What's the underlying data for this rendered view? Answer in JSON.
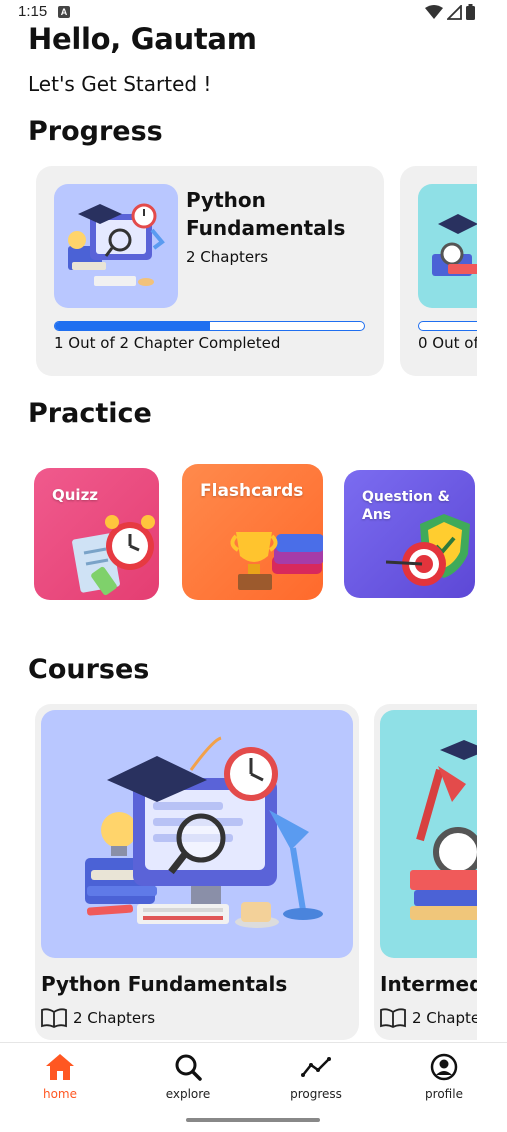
{
  "status_bar": {
    "time": "1:15",
    "notification_icon": "A"
  },
  "header": {
    "greeting": "Hello, Gautam",
    "subtitle": "Let's Get Started !"
  },
  "progress_section": {
    "title": "Progress",
    "cards": [
      {
        "title": "Python Fundamentals",
        "chapters": "2 Chapters",
        "status": "1 Out of 2 Chapter Completed",
        "progress": 0.5,
        "icon": "computer-learning-illustration"
      },
      {
        "status": "0 Out of",
        "progress": 0,
        "icon": "lamp-clock-illustration"
      }
    ]
  },
  "practice_section": {
    "title": "Practice",
    "tiles": [
      {
        "label": "Quizz",
        "color": "#e8457d",
        "icon": "alarm-clock-checklist-icon"
      },
      {
        "label": "Flashcards",
        "color": "#ff6a3d",
        "icon": "trophy-cards-icon"
      },
      {
        "label": "Question & Ans",
        "color": "#6e58e8",
        "icon": "target-shield-icon"
      }
    ]
  },
  "courses_section": {
    "title": "Courses",
    "cards": [
      {
        "title": "Python Fundamentals",
        "chapters": "2 Chapters",
        "icon": "computer-learning-illustration"
      },
      {
        "title": "Intermed",
        "chapters": "2 Chapte",
        "icon": "lamp-clock-illustration"
      }
    ]
  },
  "bottom_nav": {
    "items": [
      {
        "label": "home",
        "icon": "home-icon",
        "active": true
      },
      {
        "label": "explore",
        "icon": "search-icon",
        "active": false
      },
      {
        "label": "progress",
        "icon": "trend-icon",
        "active": false
      },
      {
        "label": "profile",
        "icon": "profile-icon",
        "active": false
      }
    ],
    "active_color": "#ff5722"
  }
}
